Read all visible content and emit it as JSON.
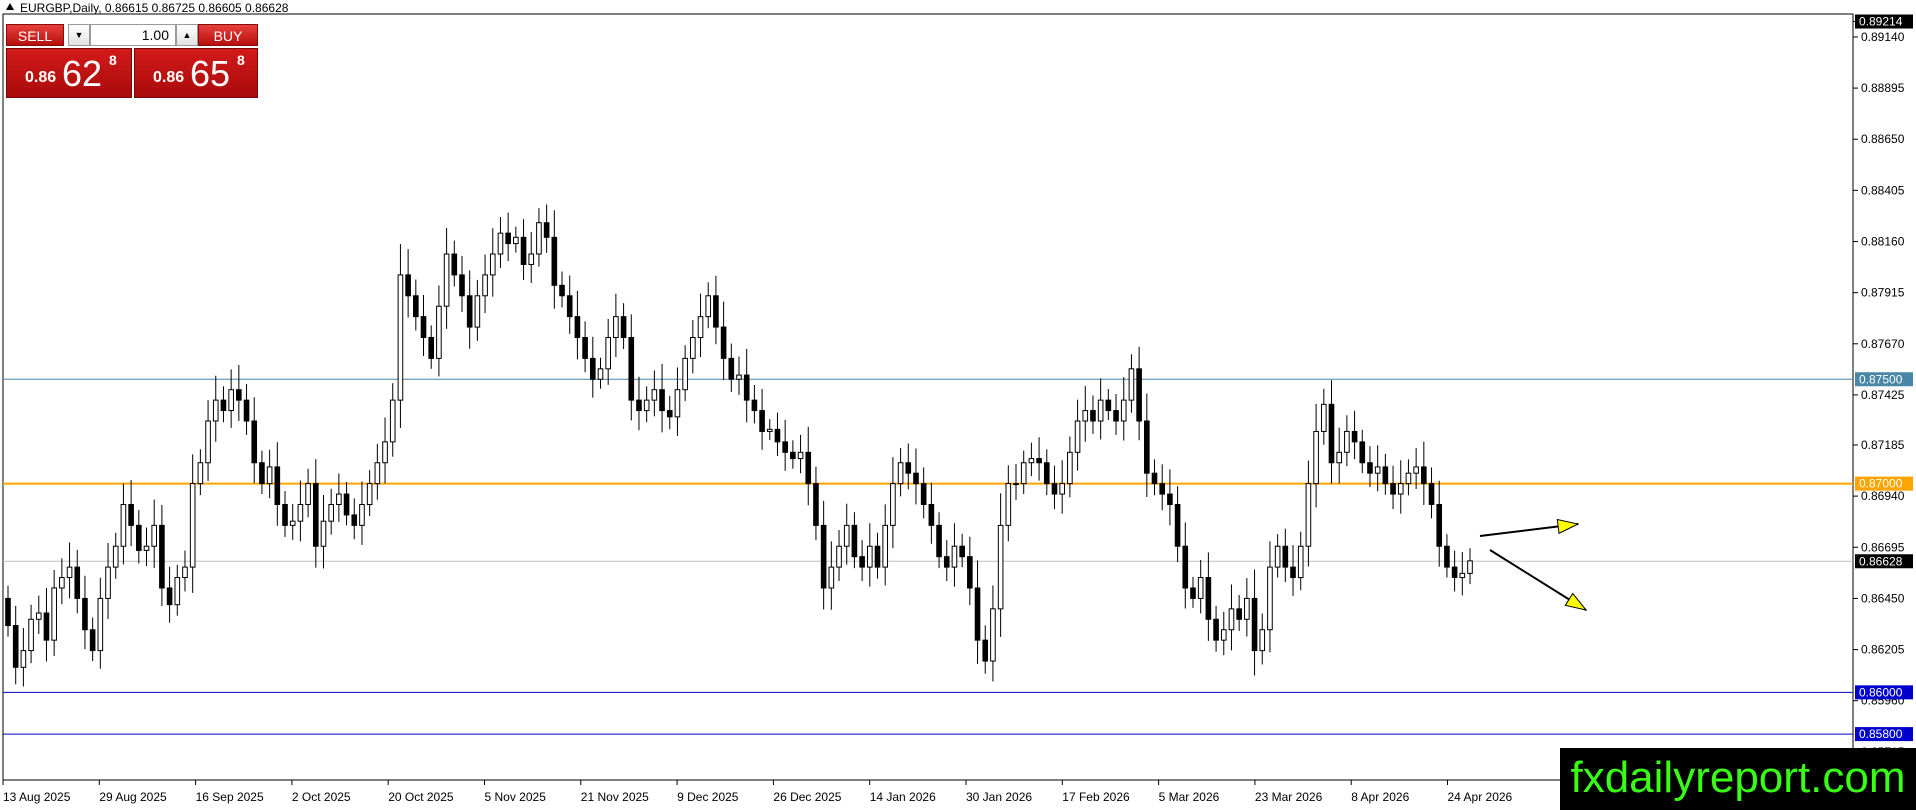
{
  "header": {
    "symbol": "EURGBP,Daily",
    "ohlc": "0.86615 0.86725 0.86605 0.86628"
  },
  "trade_panel": {
    "sell_label": "SELL",
    "buy_label": "BUY",
    "lot_value": "1.00",
    "sell_price": {
      "prefix": "0.86",
      "big": "62",
      "sup": "8"
    },
    "buy_price": {
      "prefix": "0.86",
      "big": "65",
      "sup": "8"
    }
  },
  "watermark": "fxdailyreport.com",
  "colors": {
    "bull_fill": "#ffffff",
    "bear_fill": "#000000",
    "line_075": "#4a86a8",
    "line_070": "#ffa500",
    "line_support": "#0000cc",
    "arrow_fill": "#ffff00"
  },
  "chart_data": {
    "type": "candlestick",
    "y_range": [
      0.8558,
      0.8925
    ],
    "y_ticks": [
      "0.89214",
      "0.89140",
      "0.88895",
      "0.88650",
      "0.88405",
      "0.88160",
      "0.87915",
      "0.87670",
      "0.87425",
      "0.87185",
      "0.86940",
      "0.86695",
      "0.86450",
      "0.86205",
      "0.85960",
      "0.85715"
    ],
    "x_labels": [
      "13 Aug 2025",
      "29 Aug 2025",
      "16 Sep 2025",
      "2 Oct 2025",
      "20 Oct 2025",
      "5 Nov 2025",
      "21 Nov 2025",
      "9 Dec 2025",
      "26 Dec 2025",
      "14 Jan 2026",
      "30 Jan 2026",
      "17 Feb 2026",
      "5 Mar 2026",
      "23 Mar 2026",
      "8 Apr 2026",
      "24 Apr 2026"
    ],
    "levels": [
      {
        "value": 0.875,
        "label": "0.87500",
        "role": "resistance"
      },
      {
        "value": 0.87,
        "label": "0.87000",
        "role": "pivot"
      },
      {
        "value": 0.86,
        "label": "0.86000",
        "role": "support"
      },
      {
        "value": 0.858,
        "label": "0.85800",
        "role": "support"
      }
    ],
    "current_price": "0.86628",
    "top_price": "0.89214",
    "closes": [
      0.8632,
      0.8612,
      0.862,
      0.8635,
      0.8638,
      0.8625,
      0.865,
      0.8655,
      0.866,
      0.8645,
      0.863,
      0.862,
      0.8645,
      0.866,
      0.867,
      0.869,
      0.868,
      0.8668,
      0.867,
      0.868,
      0.865,
      0.8642,
      0.8655,
      0.866,
      0.87,
      0.871,
      0.873,
      0.874,
      0.8735,
      0.8745,
      0.874,
      0.873,
      0.871,
      0.87,
      0.8708,
      0.869,
      0.868,
      0.8682,
      0.869,
      0.87,
      0.867,
      0.8682,
      0.869,
      0.8695,
      0.8685,
      0.868,
      0.869,
      0.87,
      0.871,
      0.872,
      0.874,
      0.88,
      0.879,
      0.878,
      0.877,
      0.876,
      0.8785,
      0.881,
      0.88,
      0.879,
      0.8775,
      0.879,
      0.88,
      0.881,
      0.882,
      0.8815,
      0.8818,
      0.8805,
      0.881,
      0.8825,
      0.8818,
      0.8795,
      0.879,
      0.878,
      0.877,
      0.876,
      0.875,
      0.8755,
      0.877,
      0.878,
      0.877,
      0.874,
      0.8735,
      0.874,
      0.8745,
      0.8735,
      0.8732,
      0.8745,
      0.876,
      0.877,
      0.878,
      0.879,
      0.8775,
      0.876,
      0.875,
      0.8752,
      0.874,
      0.8735,
      0.8725,
      0.8726,
      0.872,
      0.8715,
      0.8712,
      0.8715,
      0.87,
      0.868,
      0.865,
      0.866,
      0.867,
      0.868,
      0.8665,
      0.866,
      0.867,
      0.866,
      0.868,
      0.87,
      0.871,
      0.8705,
      0.87,
      0.869,
      0.868,
      0.8665,
      0.866,
      0.867,
      0.8665,
      0.865,
      0.8625,
      0.8615,
      0.864,
      0.868,
      0.87,
      0.87,
      0.871,
      0.8712,
      0.871,
      0.87,
      0.8695,
      0.87,
      0.8715,
      0.873,
      0.8735,
      0.873,
      0.874,
      0.8735,
      0.873,
      0.874,
      0.8755,
      0.873,
      0.8705,
      0.87,
      0.8695,
      0.869,
      0.867,
      0.865,
      0.8645,
      0.8655,
      0.8635,
      0.8625,
      0.863,
      0.864,
      0.8635,
      0.8645,
      0.862,
      0.863,
      0.866,
      0.867,
      0.866,
      0.8655,
      0.867,
      0.87,
      0.8725,
      0.8738,
      0.871,
      0.8715,
      0.8725,
      0.872,
      0.871,
      0.8705,
      0.8708,
      0.87,
      0.8695,
      0.87,
      0.8705,
      0.8708,
      0.87,
      0.869,
      0.867,
      0.866,
      0.8655,
      0.8657,
      0.8663
    ],
    "start_open": 0.8645,
    "series_count": 193
  }
}
